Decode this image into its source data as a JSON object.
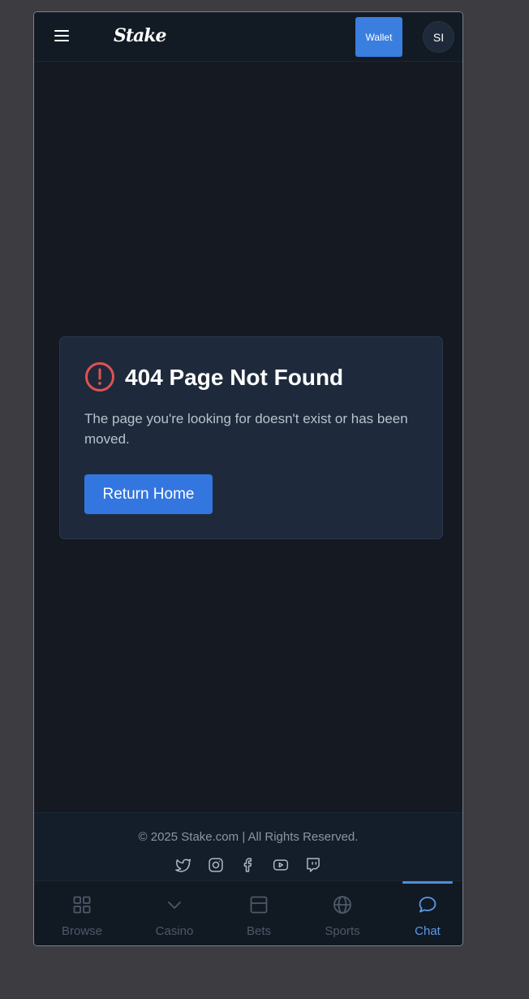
{
  "header": {
    "logo_text": "Stake",
    "wallet_label": "Wallet",
    "avatar_initials": "SI"
  },
  "error": {
    "title": "404 Page Not Found",
    "message": "The page you're looking for doesn't exist or has been moved.",
    "return_label": "Return Home"
  },
  "footer": {
    "copyright": "© 2025 Stake.com | All Rights Reserved.",
    "socials": [
      "twitter-icon",
      "instagram-icon",
      "facebook-icon",
      "youtube-icon",
      "twitch-icon"
    ]
  },
  "bottom_nav": {
    "items": [
      {
        "label": "Browse",
        "icon": "grid-icon"
      },
      {
        "label": "Casino",
        "icon": "chevron-down-icon"
      },
      {
        "label": "Bets",
        "icon": "ticket-icon"
      },
      {
        "label": "Sports",
        "icon": "globe-icon"
      },
      {
        "label": "Chat",
        "icon": "chat-bubble-icon"
      }
    ],
    "active": "Chat"
  },
  "colors": {
    "accent": "#3a7ee0",
    "error": "#e05252",
    "background": "#141922",
    "card": "#1e2a3c",
    "active_nav": "#5b9ae8"
  }
}
